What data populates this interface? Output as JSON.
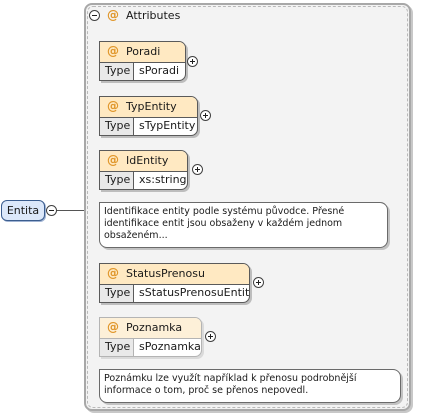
{
  "root": {
    "label": "Entita"
  },
  "group": {
    "title": "Attributes",
    "at_symbol": "@"
  },
  "attributes": [
    {
      "name": "Poradi",
      "type_label": "Type",
      "type": "sPoradi"
    },
    {
      "name": "TypEntity",
      "type_label": "Type",
      "type": "sTypEntity"
    },
    {
      "name": "IdEntity",
      "type_label": "Type",
      "type": "xs:string"
    },
    {
      "name": "StatusPrenosu",
      "type_label": "Type",
      "type": "sStatusPrenosuEntita"
    },
    {
      "name": "Poznamka",
      "type_label": "Type",
      "type": "sPoznamka"
    }
  ],
  "docs": {
    "identity": "Identifikace entity podle systému původce. Přesné identifikace entit jsou obsaženy v každém jednom obsaženém...",
    "poznamka": "Poznámku lze využít například k přenosu podrobnější informace o tom, proč se přenos nepovedl."
  },
  "colors": {
    "attribute_header": "#ffe9c2",
    "attribute_at": "#e0962a",
    "root_fill": "#dce8fa",
    "root_border": "#3b5d8f",
    "group_fill": "#f3f3f3"
  }
}
